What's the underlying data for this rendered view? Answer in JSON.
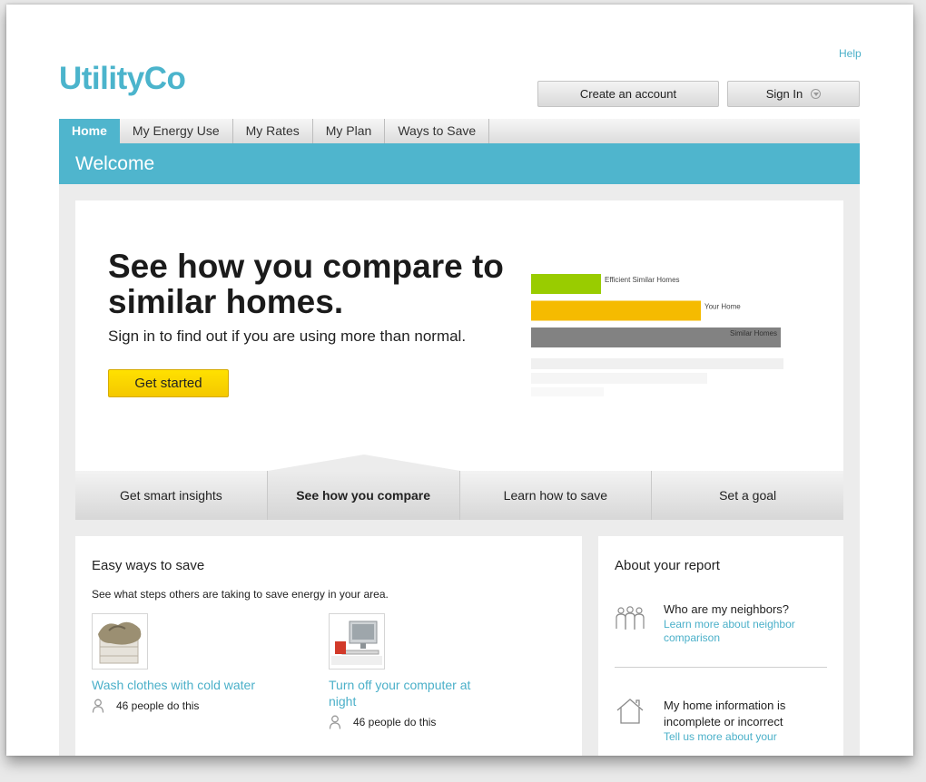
{
  "header": {
    "help_label": "Help",
    "logo_text": "UtilityCo",
    "create_account_label": "Create an account",
    "sign_in_label": "Sign In"
  },
  "nav": {
    "tabs": [
      {
        "label": "Home",
        "active": true
      },
      {
        "label": "My Energy Use",
        "active": false
      },
      {
        "label": "My Rates",
        "active": false
      },
      {
        "label": "My Plan",
        "active": false
      },
      {
        "label": "Ways to Save",
        "active": false
      }
    ]
  },
  "page_title": "Welcome",
  "hero": {
    "title": "See how you compare to similar homes.",
    "subtitle": "Sign in to find out if you are using more than normal.",
    "cta_label": "Get started",
    "comparison_bars": [
      {
        "label": "Efficient Similar Homes",
        "value": 0.28,
        "color": "#99cc00"
      },
      {
        "label": "Your Home",
        "value": 0.68,
        "color": "#f5bb00"
      },
      {
        "label": "Similar Homes",
        "value": 1.0,
        "color": "#828282"
      }
    ]
  },
  "feature_tabs": [
    {
      "label": "Get smart insights",
      "active": false
    },
    {
      "label": "See how you compare",
      "active": true
    },
    {
      "label": "Learn how to save",
      "active": false
    },
    {
      "label": "Set a goal",
      "active": false
    }
  ],
  "easy_ways": {
    "heading": "Easy ways to save",
    "subheading": "See what steps others are taking to save energy in your area.",
    "tips": [
      {
        "title": "Wash clothes with cold water",
        "count": "46 people do this",
        "icon": "laundry-basket-icon"
      },
      {
        "title": "Turn off your computer at night",
        "count": "46 people do this",
        "icon": "computer-icon"
      }
    ]
  },
  "about_report": {
    "heading": "About your report",
    "items": [
      {
        "question": "Who are my neighbors?",
        "link": "Learn more about neighbor comparison",
        "icon": "people-group-icon"
      },
      {
        "question": "My home information is incomplete or incorrect",
        "link": "Tell us more about your",
        "icon": "house-icon"
      }
    ]
  },
  "colors": {
    "brand": "#4fb5cd",
    "cta": "#ffd400",
    "link": "#4bb0c9"
  }
}
